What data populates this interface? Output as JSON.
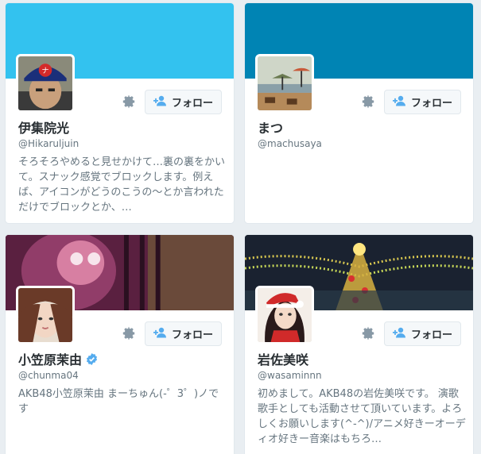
{
  "cards": [
    {
      "name": "伊集院光",
      "handle": "@Hikaruljuin",
      "bio": "そろそろやめると見せかけて…裏の裏をかいて。スナック感覚でブロックします。例えば、アイコンがどうのこうの〜とか言われただけでブロックとか、…",
      "follow_label": "フォロー",
      "banner_color": "#33c2ef",
      "verified": false
    },
    {
      "name": "まつ",
      "handle": "@machusaya",
      "bio": "",
      "follow_label": "フォロー",
      "banner_color": "#0084b4",
      "verified": false
    },
    {
      "name": "小笠原茉由",
      "handle": "@chunma04",
      "bio": "AKB48小笠原茉由 まーちゅん(-゜3゜)ノです",
      "follow_label": "フォロー",
      "banner_color": "#5a2a40",
      "verified": true
    },
    {
      "name": "岩佐美咲",
      "handle": "@wasaminnn",
      "bio": "初めまして。AKB48の岩佐美咲です。 演歌歌手としても活動させて頂いています。よろしくお願いします(^-^)/アニメ好きーオーディオ好きー音楽はもちろ…",
      "follow_label": "フォロー",
      "banner_color": "#1c2430",
      "verified": false
    }
  ],
  "colors": {
    "accent": "#55acee",
    "verified": "#55acee",
    "text": "#292f33",
    "muted": "#66757f"
  },
  "icons": [
    "gear-icon",
    "follow-person-plus-icon",
    "verified-badge-icon"
  ]
}
